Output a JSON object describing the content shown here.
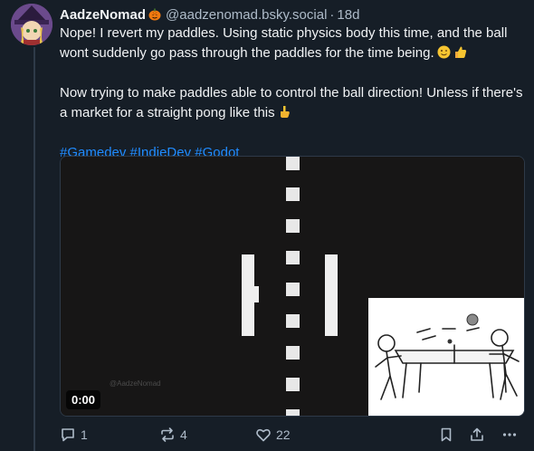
{
  "post": {
    "author": {
      "display_name": "AadzeNomad",
      "name_emoji": "pumpkin-icon",
      "handle": "@aadzenomad.bsky.social",
      "separator": "·",
      "time": "18d"
    },
    "text": {
      "line1": "Nope! I revert my paddles. Using static physics body this time, and the ball wont suddenly go pass through the paddles for the time being.",
      "line1_emojis": [
        "winking-face-icon",
        "thumbs-up-icon"
      ],
      "line2": "Now trying to make paddles able to control the ball direction! Unless if there's a market for a straight pong like this",
      "line2_emoji": "pointing-down-icon"
    },
    "hashtags": [
      "#Gamedev",
      "#IndieDev",
      "#Godot"
    ],
    "video": {
      "time": "0:00",
      "watermark": "@AadzeNomad"
    },
    "actions": {
      "replies": "1",
      "reposts": "4",
      "likes": "22"
    }
  },
  "colors": {
    "background": "#161e27",
    "text": "#f1f3f5",
    "muted": "#aebbc9",
    "link": "#208bfe"
  }
}
